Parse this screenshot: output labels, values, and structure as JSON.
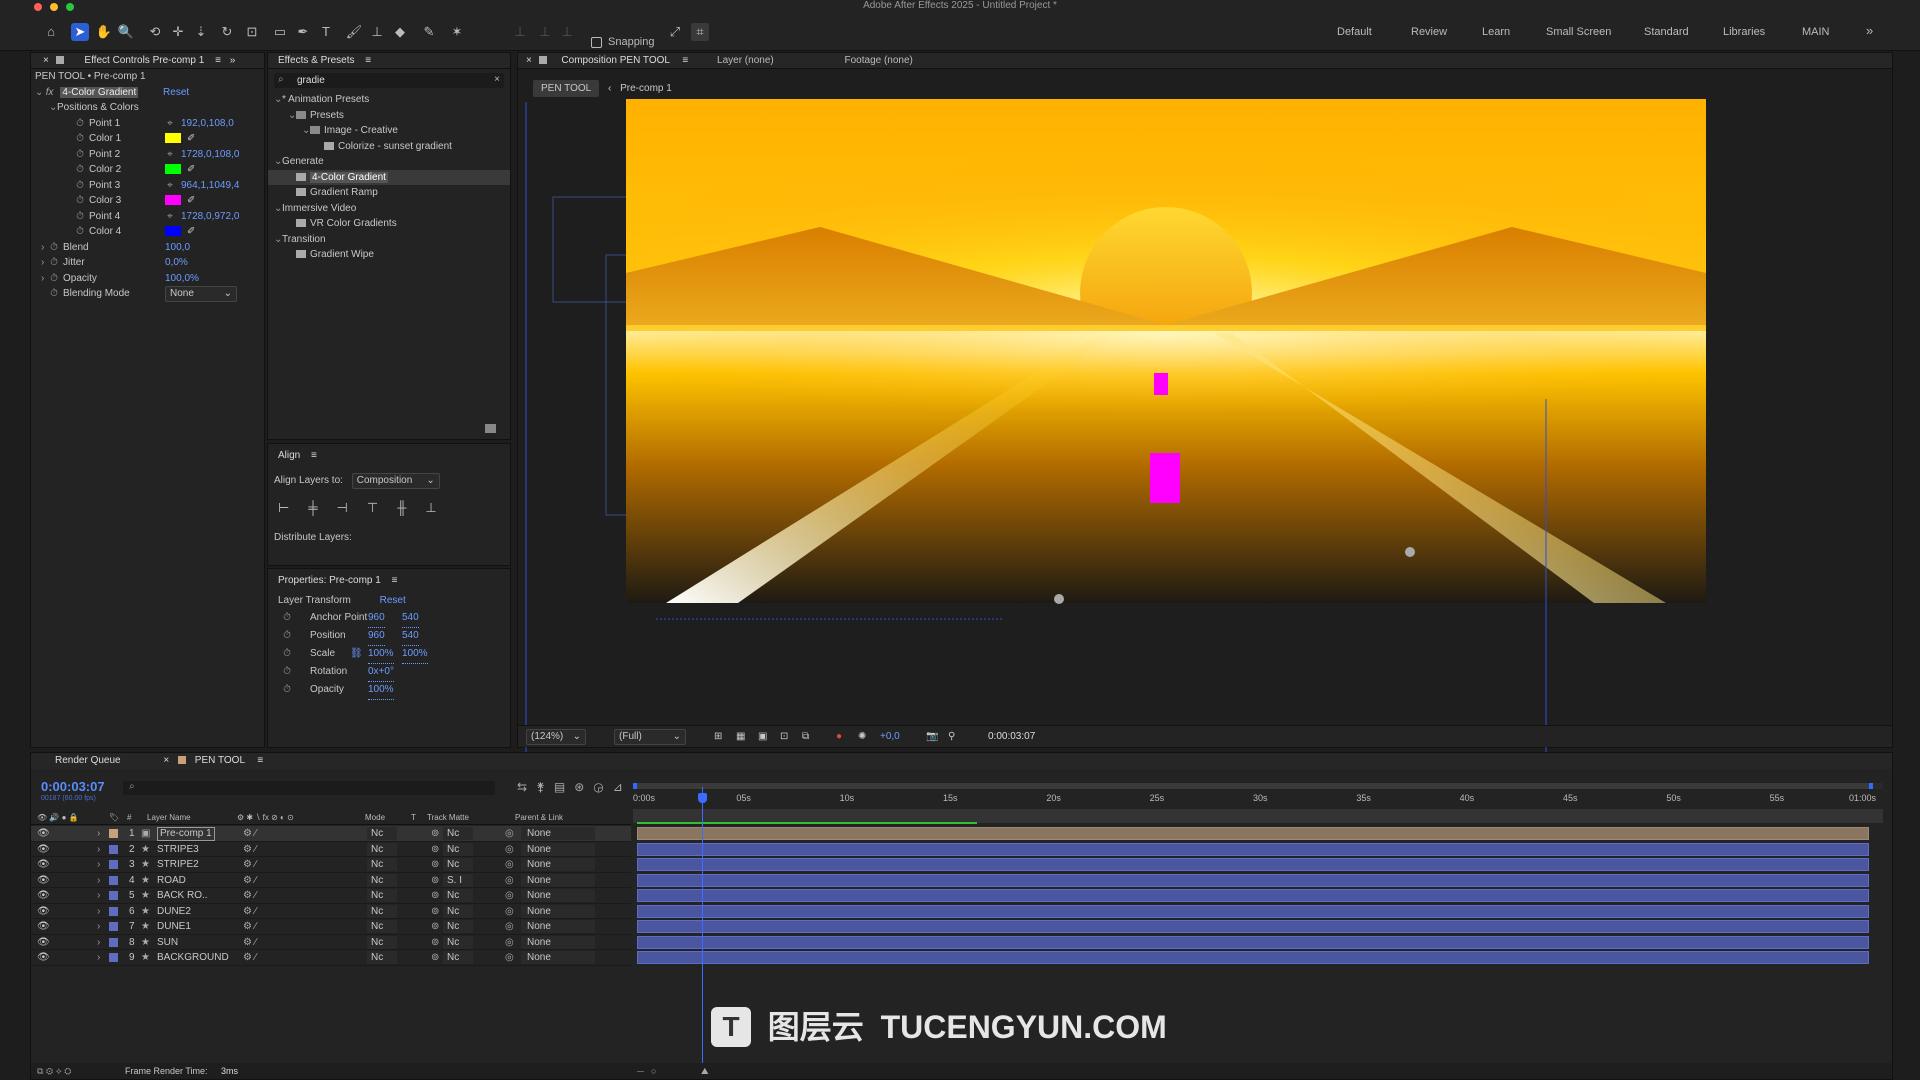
{
  "app": {
    "title": "Adobe After Effects 2025 - Untitled Project *"
  },
  "toolbar": {
    "snapping_label": "Snapping",
    "workspaces": [
      "Default",
      "Review",
      "Learn",
      "Small Screen",
      "Standard",
      "Libraries",
      "MAIN"
    ]
  },
  "effect_controls": {
    "tab": "Effect Controls Pre-comp 1",
    "breadcrumb": "PEN TOOL • Pre-comp 1",
    "effect_name": "4-Color Gradient",
    "reset": "Reset",
    "group": "Positions & Colors",
    "props": [
      {
        "label": "Point 1",
        "value": "192,0,108,0"
      },
      {
        "label": "Color 1",
        "color": "#ffff00"
      },
      {
        "label": "Point 2",
        "value": "1728,0,108,0"
      },
      {
        "label": "Color 2",
        "color": "#00ff00"
      },
      {
        "label": "Point 3",
        "value": "964,1,1049,4"
      },
      {
        "label": "Color 3",
        "color": "#ff00ff"
      },
      {
        "label": "Point 4",
        "value": "1728,0,972,0"
      },
      {
        "label": "Color 4",
        "color": "#0000ff"
      }
    ],
    "extra": [
      {
        "label": "Blend",
        "value": "100,0"
      },
      {
        "label": "Jitter",
        "value": "0,0%"
      },
      {
        "label": "Opacity",
        "value": "100,0%"
      },
      {
        "label": "Blending Mode",
        "value": "None"
      }
    ]
  },
  "effects_presets": {
    "tab": "Effects & Presets",
    "search": "gradie",
    "tree": [
      "* Animation Presets",
      "Presets",
      "Image - Creative",
      "Colorize - sunset gradient",
      "Generate",
      "4-Color Gradient",
      "Gradient Ramp",
      "Immersive Video",
      "VR Color Gradients",
      "Transition",
      "Gradient Wipe"
    ]
  },
  "align": {
    "tab": "Align",
    "align_to_label": "Align Layers to:",
    "align_to": "Composition",
    "distribute": "Distribute Layers:"
  },
  "properties": {
    "tab": "Properties: Pre-comp 1",
    "section": "Layer Transform",
    "reset": "Reset",
    "rows": [
      {
        "label": "Anchor Point",
        "v1": "960",
        "v2": "540"
      },
      {
        "label": "Position",
        "v1": "960",
        "v2": "540"
      },
      {
        "label": "Scale",
        "v1": "100%",
        "v2": "100%"
      },
      {
        "label": "Rotation",
        "v1": "0x+0°",
        "v2": ""
      },
      {
        "label": "Opacity",
        "v1": "100%",
        "v2": ""
      }
    ]
  },
  "viewer": {
    "tab": "Composition PEN TOOL",
    "layer_tab": "Layer (none)",
    "footage_tab": "Footage (none)",
    "crumb1": "PEN TOOL",
    "crumb2": "Pre-comp 1",
    "zoom": "(124%)",
    "resolution": "(Full)",
    "exposure": "+0,0",
    "timecode": "0:00:03:07"
  },
  "timeline": {
    "render_queue": "Render Queue",
    "tab": "PEN TOOL",
    "timecode": "0:00:03:07",
    "frames": "00187 (60.00 fps)",
    "headers": {
      "layer_name": "Layer Name",
      "mode": "Mode",
      "t": "T",
      "track_matte": "Track Matte",
      "parent": "Parent & Link"
    },
    "ruler": [
      "0:00s",
      "05s",
      "10s",
      "15s",
      "20s",
      "25s",
      "30s",
      "35s",
      "40s",
      "45s",
      "50s",
      "55s",
      "01:00s"
    ],
    "layers": [
      {
        "num": "1",
        "name": "Pre-comp 1",
        "mode": "Nc",
        "matte": "Nc",
        "parent": "None",
        "color": "#c8a07a"
      },
      {
        "num": "2",
        "name": "STRIPE3",
        "mode": "Nc",
        "matte": "Nc",
        "parent": "None",
        "color": "#5e6cc2"
      },
      {
        "num": "3",
        "name": "STRIPE2",
        "mode": "Nc",
        "matte": "Nc",
        "parent": "None",
        "color": "#5e6cc2"
      },
      {
        "num": "4",
        "name": "ROAD",
        "mode": "Nc",
        "matte": "S. I",
        "parent": "None",
        "color": "#5e6cc2"
      },
      {
        "num": "5",
        "name": "BACK RO..",
        "mode": "Nc",
        "matte": "Nc",
        "parent": "None",
        "color": "#5e6cc2"
      },
      {
        "num": "6",
        "name": "DUNE2",
        "mode": "Nc",
        "matte": "Nc",
        "parent": "None",
        "color": "#5e6cc2"
      },
      {
        "num": "7",
        "name": "DUNE1",
        "mode": "Nc",
        "matte": "Nc",
        "parent": "None",
        "color": "#5e6cc2"
      },
      {
        "num": "8",
        "name": "SUN",
        "mode": "Nc",
        "matte": "Nc",
        "parent": "None",
        "color": "#5e6cc2"
      },
      {
        "num": "9",
        "name": "BACKGROUND",
        "mode": "Nc",
        "matte": "Nc",
        "parent": "None",
        "color": "#5e6cc2"
      }
    ],
    "frame_render_label": "Frame Render Time:",
    "frame_render_value": "3ms"
  },
  "watermark": {
    "cn": "图层云",
    "en": "TUCENGYUN.COM"
  }
}
